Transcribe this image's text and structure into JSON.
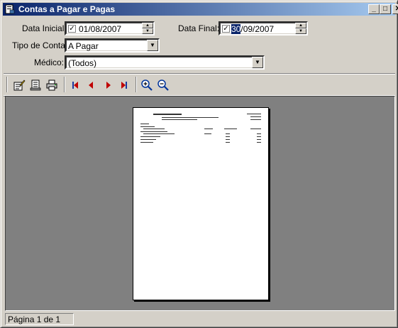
{
  "window": {
    "title": "Contas a Pagar e Pagas",
    "controls": {
      "minimize": "_",
      "maximize": "□",
      "close": "✕"
    }
  },
  "filters": {
    "data_inicial": {
      "label": "Data Inicial:",
      "value": "01/08/2007",
      "checked": true
    },
    "data_final": {
      "label": "Data Final:",
      "value_selected": "30",
      "value_rest": "/09/2007",
      "checked": true
    },
    "tipo_conta": {
      "label": "Tipo de Conta:",
      "value": "A Pagar"
    },
    "medico": {
      "label": "Médico:",
      "value": "(Todos)"
    }
  },
  "toolbar": {
    "icons": [
      "edit-icon",
      "page-setup-icon",
      "print-icon",
      "first-page-icon",
      "prev-page-icon",
      "next-page-icon",
      "last-page-icon",
      "zoom-in-icon",
      "zoom-out-icon"
    ]
  },
  "status": {
    "page_text": "Página 1 de 1"
  },
  "colors": {
    "title_start": "#0a246a",
    "title_end": "#a6caf0",
    "face": "#d4d0c8",
    "preview_bg": "#808080",
    "nav_red": "#c00000",
    "zoom_blue": "#003399"
  }
}
